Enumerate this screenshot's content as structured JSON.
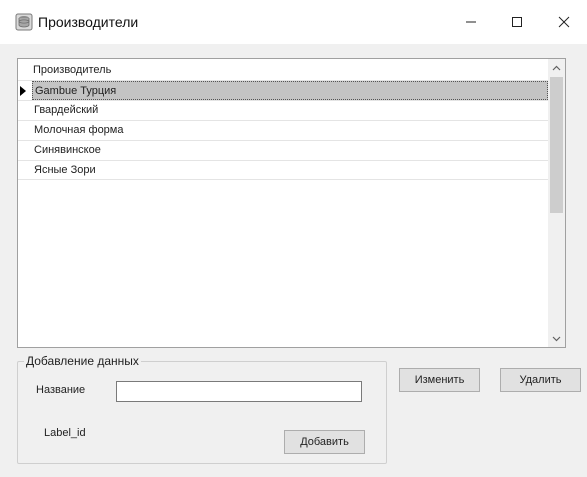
{
  "window": {
    "title": "Производители",
    "controls": {
      "minimize": "–",
      "maximize": "□",
      "close": "✕"
    },
    "icon": "database-app-icon"
  },
  "grid": {
    "column_header": "Производитель",
    "rows": [
      {
        "name": "Gambue Турция",
        "selected": true
      },
      {
        "name": "Гвардейский",
        "selected": false
      },
      {
        "name": "Молочная форма",
        "selected": false
      },
      {
        "name": "Синявинское",
        "selected": false
      },
      {
        "name": "Ясные Зори",
        "selected": false
      }
    ],
    "current_row_indicator": "▶"
  },
  "add_group": {
    "legend": "Добавление данных",
    "name_label": "Название",
    "name_value": "",
    "id_label": "Label_id",
    "add_button": "Добавить"
  },
  "actions": {
    "edit_button": "Изменить",
    "delete_button": "Удалить"
  }
}
